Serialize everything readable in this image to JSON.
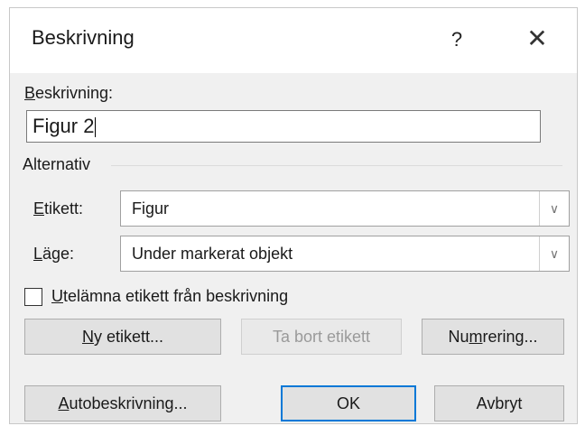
{
  "window": {
    "title": "Beskrivning",
    "help_label": "?",
    "close_label": "✕"
  },
  "caption": {
    "label_underlined": "B",
    "label_rest": "eskrivning:",
    "value": "Figur 2"
  },
  "options": {
    "group_label": "Alternativ",
    "label_field": {
      "label_underlined": "E",
      "label_rest": "tikett:",
      "value": "Figur"
    },
    "position_field": {
      "label_underlined": "L",
      "label_rest": "äge:",
      "value": "Under markerat objekt"
    },
    "exclude_label": {
      "checked": false,
      "label_underlined": "U",
      "label_rest": "telämna etikett från beskrivning"
    }
  },
  "buttons": {
    "new_label": {
      "pre": "",
      "underlined": "N",
      "post": "y etikett..."
    },
    "delete_label": {
      "text": "Ta bort etikett"
    },
    "numbering": {
      "pre": "Nu",
      "underlined": "m",
      "post": "rering..."
    },
    "autocaption": {
      "pre": "",
      "underlined": "A",
      "post": "utobeskrivning..."
    },
    "ok": {
      "text": "OK"
    },
    "cancel": {
      "text": "Avbryt"
    }
  },
  "colors": {
    "dialog_bg": "#f0f0f0",
    "titlebar_bg": "#ffffff",
    "default_button_border": "#0078d7"
  }
}
